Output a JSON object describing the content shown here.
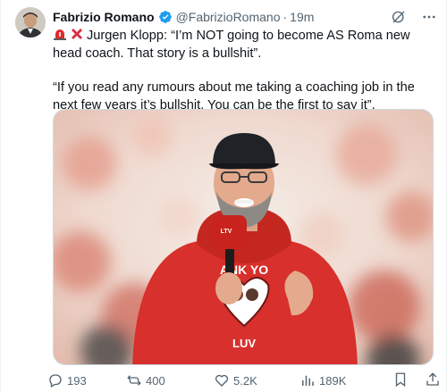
{
  "author": {
    "name": "Fabrizio Romano",
    "handle": "@FabrizioRomano",
    "separator": "·",
    "time": "19m"
  },
  "header_icons": [
    "grok-icon",
    "more-icon"
  ],
  "tweet": {
    "line1": "Jurgen Klopp: “I’m NOT going to become AS Roma new head coach. That story is a bullshit”.",
    "line2": "“If you read any rumours about me taking a coaching job in the next few years it’s bullshit. You can be the first to say it”.",
    "emojis": [
      "siren-emoji",
      "cross-mark-emoji"
    ]
  },
  "media": {
    "shirt_text_top": "ANK YO",
    "shirt_text_bottom": "LUV",
    "mic_brand": "LTV"
  },
  "actions": {
    "replies": "193",
    "reposts": "400",
    "likes": "5.2K",
    "views": "189K"
  },
  "colors": {
    "text": "#0f1419",
    "secondary": "#536471",
    "verified": "#1d9bf0",
    "cross": "#e0245e",
    "hoodie": "#d8302c"
  }
}
